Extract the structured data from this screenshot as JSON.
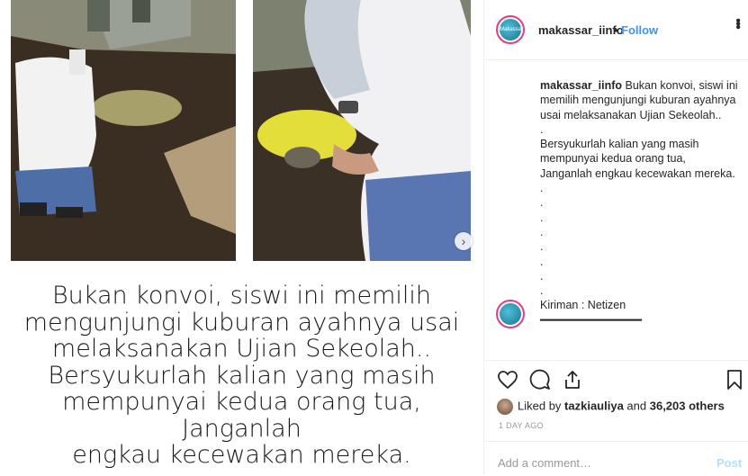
{
  "post": {
    "overlay_caption": "Bukan konvoi, siswi ini memilih\nmengunjungi kuburan ayahnya usai\nmelaksanakan Ujian Sekeolah..\nBersyukurlah kalian yang masih\nmempunyai kedua orang tua, Janganlah\nengkau kecewakan mereka."
  },
  "header": {
    "avatar_text": "Makassar info",
    "username": "makassar_iinfo",
    "separator": "•",
    "follow_label": "Follow",
    "more_icon": "more-options-icon"
  },
  "caption": {
    "username": "makassar_iinfo",
    "text": " Bukan konvoi, siswi ini memilih mengunjungi kuburan ayahnya usai melaksanakan Ujian Sekeolah..\n.\nBersyukurlah kalian yang masih mempunyai kedua orang tua, Janganlah engkau kecewakan mereka.\n.\n.\n.\n.\n.\n.\n.\n.\nKiriman : Netizen\n━━━━━━━━━━━━━━━"
  },
  "actions": {
    "icons": [
      "heart-icon",
      "comment-icon",
      "share-icon",
      "bookmark-icon"
    ],
    "liked_prefix": "Liked by ",
    "liked_user": "tazkiauliya",
    "liked_middle": " and ",
    "liked_count": "36,203 others",
    "timestamp": "1 DAY AGO"
  },
  "comment_box": {
    "placeholder": "Add a comment…",
    "post_label": "Post"
  },
  "colors": {
    "accent": "#3897f0",
    "post_disabled": "#b2dffc",
    "avatar_ring": "#e23d82"
  }
}
